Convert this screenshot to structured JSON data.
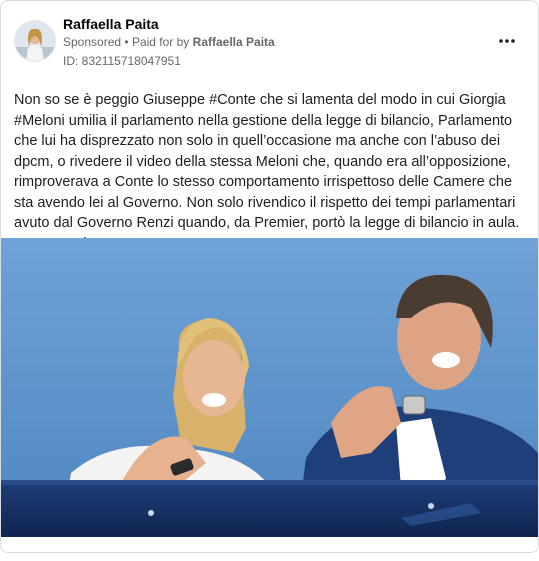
{
  "post": {
    "author": "Raffaella Paita",
    "sponsored_label": "Sponsored",
    "separator": "•",
    "paid_for_label": "Paid for by",
    "payer": "Raffaella Paita",
    "ad_id": "ID: 832115718047951",
    "more_icon": "more-horizontal-icon",
    "text": "Non so se è peggio Giuseppe #Conte che si lamenta del modo in cui Giorgia #Meloni umilia il parlamento nella gestione della legge di bilancio, Parlamento che lui ha disprezzato non solo in quell’occasione ma anche con l’abuso dei dpcm, o rivedere il video della stessa Meloni che, quando era all’opposizione, rimproverava a Conte lo stesso comportamento irrispettoso delle Camere che sta avendo lei al Governo. Non solo rivendico il rispetto dei tempi parlamentari avuto dal Governo Renzi quando, da Premier, portò la legge di bilancio in aula. Pongo anche una…"
  },
  "colors": {
    "sky": "#5e94cc",
    "border": "#dadde1",
    "meta_text": "#65676b"
  }
}
